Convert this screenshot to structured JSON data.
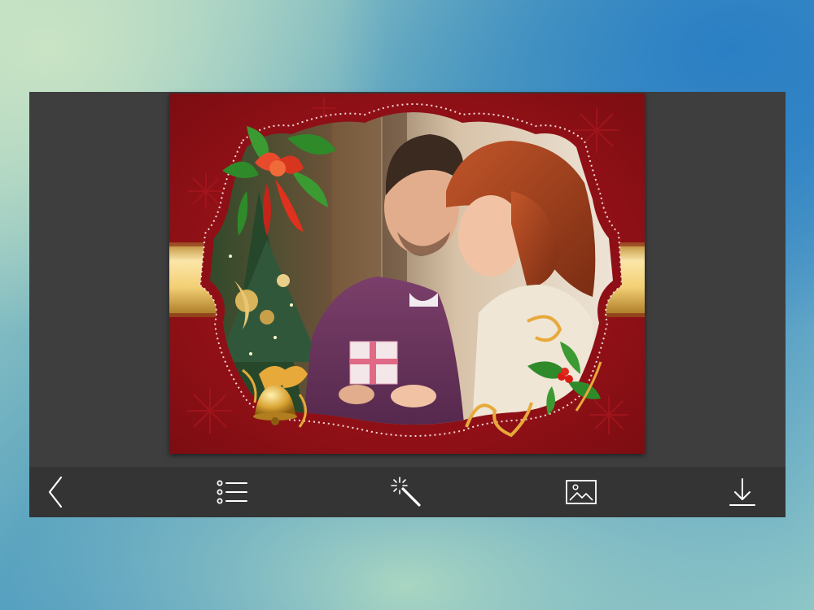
{
  "toolbar": {
    "back": {
      "label": "",
      "icon": "chevron-left-icon"
    },
    "frames": {
      "label": "",
      "icon": "list-icon"
    },
    "effects": {
      "label": "",
      "icon": "magic-wand-icon"
    },
    "gallery": {
      "label": "",
      "icon": "image-icon"
    },
    "download": {
      "label": "",
      "icon": "download-icon"
    }
  },
  "frame": {
    "theme": "christmas",
    "colors": {
      "card_red": "#8e1016",
      "ribbon_gold": "#f4d37a",
      "holly_green": "#2f8a2a",
      "bow_red": "#e0301e",
      "toolbar_bg": "#343434",
      "panel_bg": "#3e3e3e"
    }
  }
}
